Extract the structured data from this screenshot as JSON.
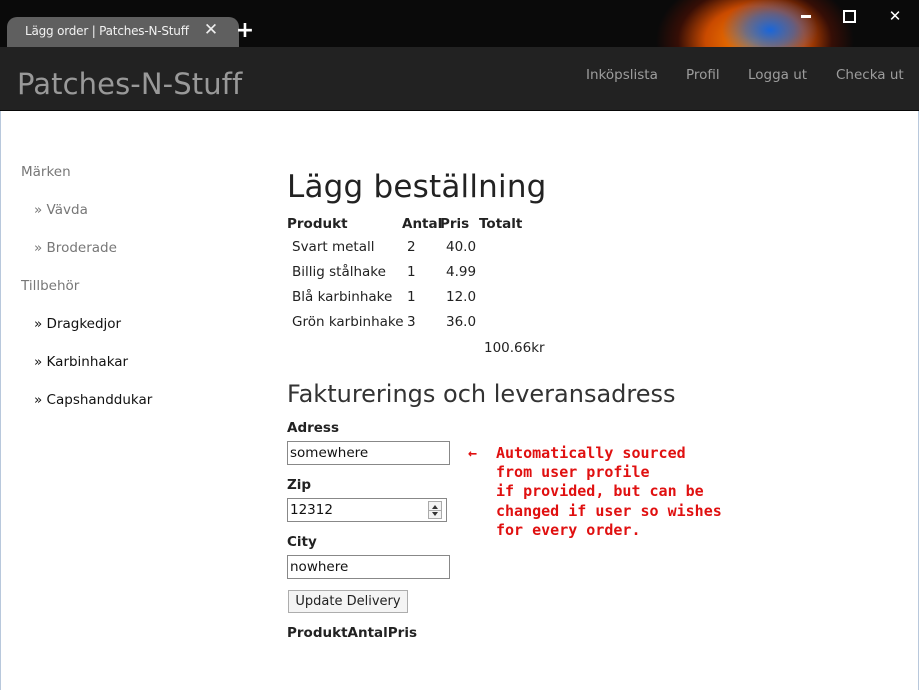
{
  "browser": {
    "tab_title": "Lägg order | Patches-N-Stuff",
    "tab_close": "✕",
    "new_tab": "+",
    "window_close": "✕"
  },
  "navbar": {
    "brand": "Patches-N-Stuff",
    "links": [
      "Inköpslista",
      "Profil",
      "Logga ut",
      "Checka ut"
    ]
  },
  "sidebar": {
    "sections": [
      {
        "heading": "Märken",
        "items": [
          "» Vävda",
          "» Broderade"
        ]
      },
      {
        "heading": "Tillbehör",
        "items": [
          "» Dragkedjor",
          "» Karbinhakar",
          "» Capshanddukar"
        ]
      }
    ]
  },
  "order": {
    "title": "Lägg beställning",
    "headers": [
      "Produkt",
      "Antal",
      "Pris",
      "Totalt"
    ],
    "rows": [
      {
        "product": "Svart metall",
        "qty": "2",
        "price": "40.0"
      },
      {
        "product": "Billig stålhake",
        "qty": "1",
        "price": "4.99"
      },
      {
        "product": "Blå karbinhake",
        "qty": "1",
        "price": "12.0"
      },
      {
        "product": "Grön karbinhake",
        "qty": "3",
        "price": "36.0"
      }
    ],
    "total": "100.66kr"
  },
  "address": {
    "title": "Fakturerings och leveransadress",
    "address_label": "Adress",
    "address_value": "somewhere",
    "zip_label": "Zip",
    "zip_value": "12312",
    "city_label": "City",
    "city_value": "nowhere",
    "update_button": "Update Delivery",
    "footer_headers": "ProduktAntalPris"
  },
  "annotation": {
    "arrow": "←",
    "lines": [
      "Automatically sourced",
      "from user profile",
      "if provided, but can be",
      "changed if user so wishes",
      "for every order."
    ],
    "color": "#e01010"
  }
}
